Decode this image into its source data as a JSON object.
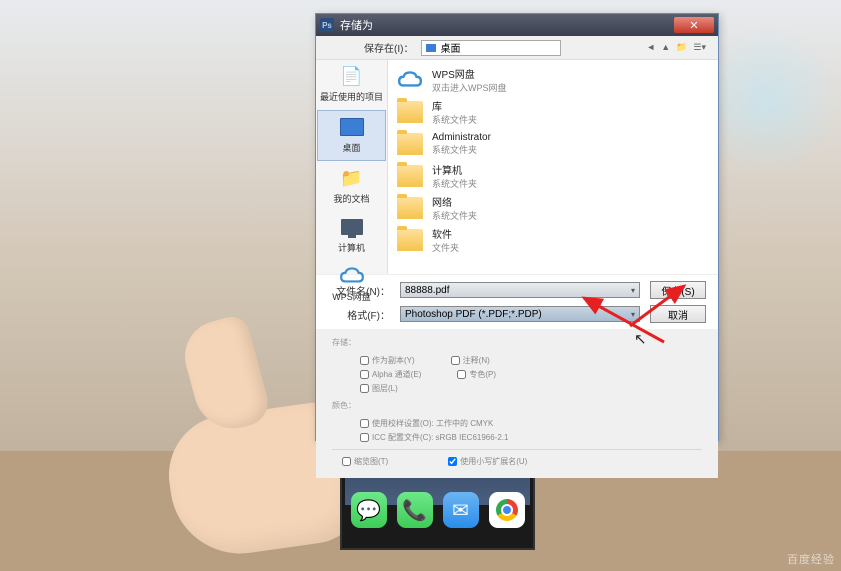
{
  "dialog": {
    "title": "存储为",
    "ps_badge": "Ps",
    "close": "✕",
    "savein_label": "保存在(I)：",
    "savein_value": "桌面",
    "places": [
      {
        "id": "recent",
        "label": "最近使用的项目",
        "icon": "📄"
      },
      {
        "id": "desktop",
        "label": "桌面",
        "icon": "🖥",
        "selected": true
      },
      {
        "id": "documents",
        "label": "我的文档",
        "icon": "📁"
      },
      {
        "id": "computer",
        "label": "计算机",
        "icon": "💻"
      },
      {
        "id": "wps",
        "label": "WPS网盘",
        "icon": "☁"
      }
    ],
    "files": [
      {
        "icon": "cloud",
        "name": "WPS网盘",
        "sub": "双击进入WPS网盘"
      },
      {
        "icon": "folder-lib",
        "name": "库",
        "sub": "系统文件夹"
      },
      {
        "icon": "folder-user",
        "name": "Administrator",
        "sub": "系统文件夹"
      },
      {
        "icon": "folder-pc",
        "name": "计算机",
        "sub": "系统文件夹"
      },
      {
        "icon": "folder-net",
        "name": "网络",
        "sub": "系统文件夹"
      },
      {
        "icon": "folder",
        "name": "软件",
        "sub": "文件夹"
      }
    ],
    "filename_label": "文件名(N)：",
    "filename_value": "88888.pdf",
    "format_label": "格式(F)：",
    "format_value": "Photoshop PDF (*.PDF;*.PDP)",
    "save_btn": "保存(S)",
    "cancel_btn": "取消",
    "options": {
      "save_section": "存储：",
      "save_copy": "作为副本(Y)",
      "notes": "注释(N)",
      "alpha": "Alpha 通道(E)",
      "spot": "专色(P)",
      "layers": "图层(L)",
      "color_section": "颜色：",
      "proof": "使用校样设置(O): 工作中的 CMYK",
      "icc": "ICC 配置文件(C): sRGB IEC61966-2.1",
      "thumbnail": "缩览图(T)",
      "lowercase_ext": "使用小写扩展名(U)"
    }
  },
  "watermark": "百度经验"
}
